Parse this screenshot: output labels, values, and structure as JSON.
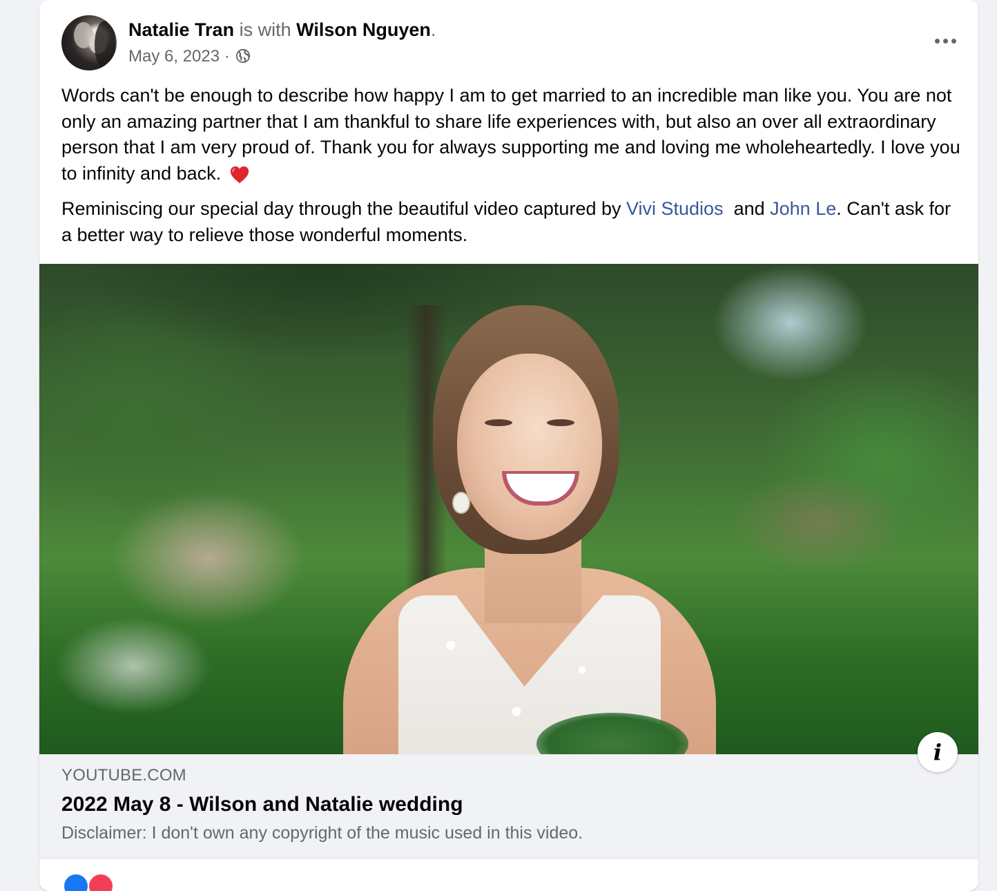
{
  "post": {
    "author": "Natalie Tran",
    "with_text": "is with",
    "tagged": "Wilson Nguyen",
    "period": ".",
    "date": "May 6, 2023",
    "separator": "·",
    "privacy_icon": "globe-icon",
    "more_icon": "more-options-icon",
    "paragraph1": "Words can't be enough to describe how happy I am to get married to an incredible man like you. You are not only an amazing partner that I am thankful to share life experiences with, but also an over all extraordinary person that I am very proud of. Thank you for always supporting me and loving me wholeheartedly. I love you to infinity and back.",
    "heart_emoji": "heart-icon",
    "paragraph2_start": "Reminiscing our special day through the beautiful video captured by ",
    "link1": "Vivi Studios",
    "paragraph2_mid": "  and ",
    "link2": "John Le",
    "paragraph2_end": ". Can't ask for a better way to relieve those wonderful moments."
  },
  "link_preview": {
    "domain": "YOUTUBE.COM",
    "title": "2022 May 8 - Wilson and Natalie wedding",
    "description": "Disclaimer: I don't own any copyright of the music used in this video.",
    "info_label": "i"
  },
  "colors": {
    "link": "#385898",
    "muted": "#65676b",
    "text": "#050505",
    "like": "#1877f2",
    "love": "#f33e58"
  }
}
